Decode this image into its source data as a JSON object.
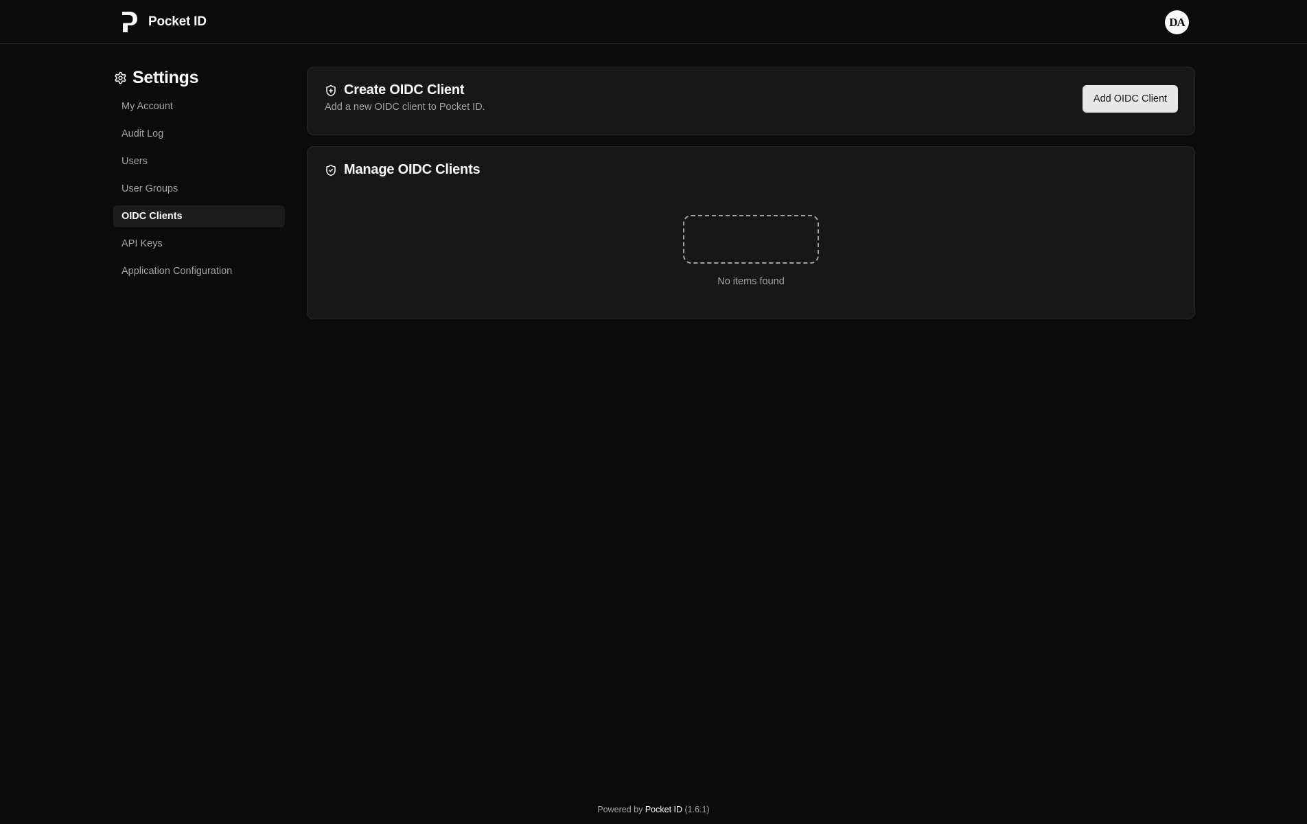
{
  "header": {
    "app_name": "Pocket ID",
    "avatar_initials": "DA"
  },
  "sidebar": {
    "title": "Settings",
    "items": [
      {
        "label": "My Account"
      },
      {
        "label": "Audit Log"
      },
      {
        "label": "Users"
      },
      {
        "label": "User Groups"
      },
      {
        "label": "OIDC Clients",
        "active": true
      },
      {
        "label": "API Keys"
      },
      {
        "label": "Application Configuration"
      }
    ]
  },
  "create_card": {
    "title": "Create OIDC Client",
    "description": "Add a new OIDC client to Pocket ID.",
    "button_label": "Add OIDC Client"
  },
  "manage_card": {
    "title": "Manage OIDC Clients",
    "empty_text": "No items found"
  },
  "footer": {
    "prefix": "Powered by",
    "brand": "Pocket ID",
    "version": "(1.6.1)"
  },
  "colors": {
    "background": "#0b0b0b",
    "card": "#171717",
    "border": "#262626",
    "muted_text": "#a3a3a3",
    "active_nav": "#1c1c1c",
    "button_bg": "#e8e8e8"
  }
}
